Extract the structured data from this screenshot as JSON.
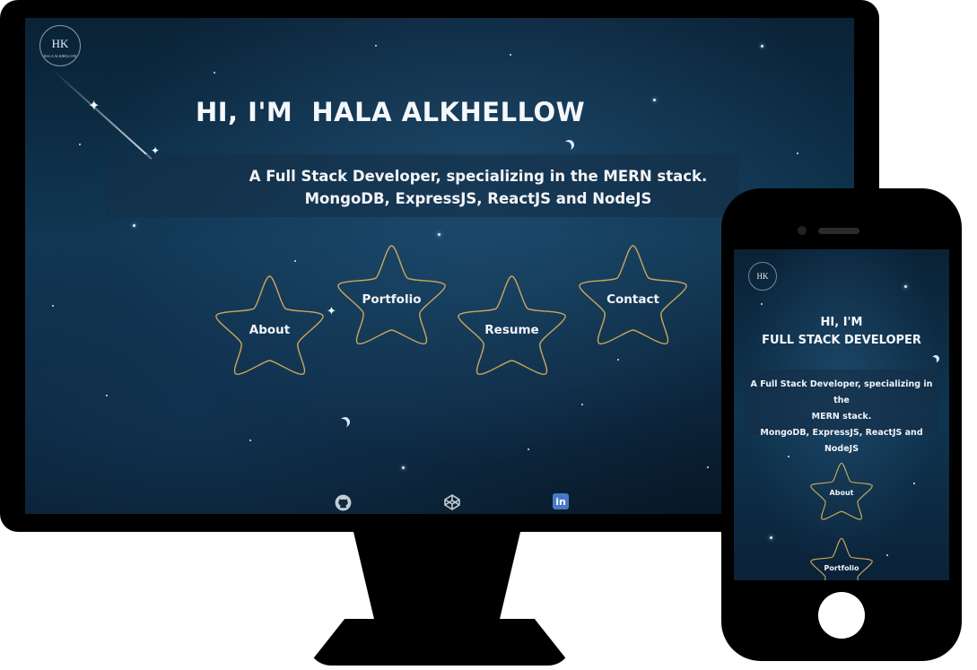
{
  "desktop": {
    "logo": {
      "initials": "HK",
      "subtext": "HALA ALKHELLOW"
    },
    "hero_title": "HI, I'M  HALA ALKHELLOW",
    "tagline_line1": "A Full Stack Developer, specializing in the MERN stack.",
    "tagline_line2": "MongoDB, ExpressJS, ReactJS and NodeJS",
    "nav": [
      {
        "label": "About",
        "icon": "info-circle-icon"
      },
      {
        "label": "Portfolio",
        "icon": "briefcase-icon"
      },
      {
        "label": "Resume",
        "icon": "file-icon"
      },
      {
        "label": "Contact",
        "icon": "envelope-icon"
      }
    ],
    "socials": [
      {
        "name": "github-icon"
      },
      {
        "name": "codepen-icon"
      },
      {
        "name": "linkedin-icon",
        "text": "in",
        "color": "#4a78c7"
      }
    ],
    "star_outline_color": "#c9a85a"
  },
  "mobile": {
    "logo": {
      "initials": "HK"
    },
    "title_line1": "HI, I'M",
    "title_line2": "FULL STACK DEVELOPER",
    "tagline_line1": "A Full Stack Developer, specializing in the",
    "tagline_line2": "MERN stack.",
    "tagline_line3": "MongoDB, ExpressJS, ReactJS and NodeJS",
    "nav": [
      {
        "label": "About",
        "icon": "info-circle-icon"
      },
      {
        "label": "Portfolio",
        "icon": "briefcase-icon"
      }
    ]
  }
}
